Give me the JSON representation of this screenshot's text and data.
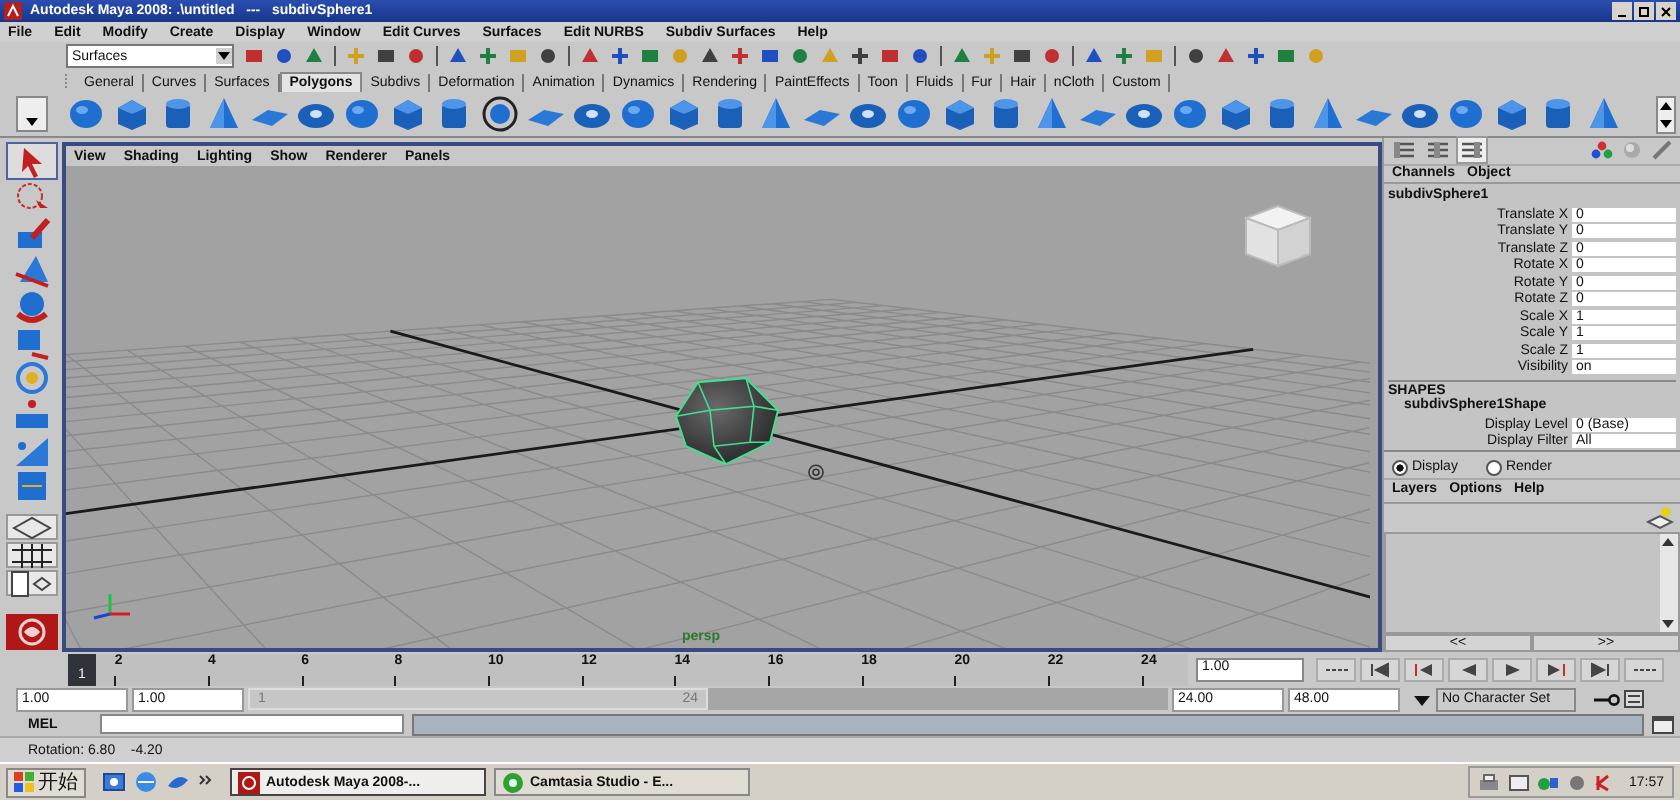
{
  "window": {
    "title": "Autodesk Maya 2008: .\\untitled   ---   subdivSphere1"
  },
  "menus": [
    "File",
    "Edit",
    "Modify",
    "Create",
    "Display",
    "Window",
    "Edit Curves",
    "Surfaces",
    "Edit NURBS",
    "Subdiv Surfaces",
    "Help"
  ],
  "status_line": {
    "menu_set": "Surfaces"
  },
  "shelf": {
    "tabs": [
      {
        "label": "General",
        "selected": false
      },
      {
        "label": "Curves",
        "selected": false
      },
      {
        "label": "Surfaces",
        "selected": false
      },
      {
        "label": "Polygons",
        "selected": true
      },
      {
        "label": "Subdivs",
        "selected": false
      },
      {
        "label": "Deformation",
        "selected": false
      },
      {
        "label": "Animation",
        "selected": false
      },
      {
        "label": "Dynamics",
        "selected": false
      },
      {
        "label": "Rendering",
        "selected": false
      },
      {
        "label": "PaintEffects",
        "selected": false
      },
      {
        "label": "Toon",
        "selected": false
      },
      {
        "label": "Fluids",
        "selected": false
      },
      {
        "label": "Fur",
        "selected": false
      },
      {
        "label": "Hair",
        "selected": false
      },
      {
        "label": "nCloth",
        "selected": false
      },
      {
        "label": "Custom",
        "selected": false
      }
    ]
  },
  "viewport": {
    "menus": [
      "View",
      "Shading",
      "Lighting",
      "Show",
      "Renderer",
      "Panels"
    ],
    "camera": "persp"
  },
  "channel_box": {
    "menus": [
      "Channels",
      "Object"
    ],
    "object": "subdivSphere1",
    "attributes": [
      {
        "name": "Translate X",
        "value": "0"
      },
      {
        "name": "Translate Y",
        "value": "0"
      },
      {
        "name": "Translate Z",
        "value": "0"
      },
      {
        "name": "Rotate X",
        "value": "0"
      },
      {
        "name": "Rotate Y",
        "value": "0"
      },
      {
        "name": "Rotate Z",
        "value": "0"
      },
      {
        "name": "Scale X",
        "value": "1"
      },
      {
        "name": "Scale Y",
        "value": "1"
      },
      {
        "name": "Scale Z",
        "value": "1"
      },
      {
        "name": "Visibility",
        "value": "on"
      }
    ],
    "shapes_heading": "SHAPES",
    "shape": "subdivSphere1Shape",
    "shape_attributes": [
      {
        "name": "Display Level",
        "value": "0 (Base)"
      },
      {
        "name": "Display Filter",
        "value": "All"
      }
    ]
  },
  "layer_editor": {
    "modes": [
      {
        "label": "Display",
        "selected": true
      },
      {
        "label": "Render",
        "selected": false
      }
    ],
    "menus": [
      "Layers",
      "Options",
      "Help"
    ],
    "scroll_left": "<<",
    "scroll_right": ">>"
  },
  "time_slider": {
    "current_frame": "1",
    "level": 0,
    "labels": [
      "2",
      "4",
      "6",
      "8",
      "10",
      "12",
      "14",
      "16",
      "18",
      "20",
      "22",
      "24"
    ],
    "current_time": "1.00"
  },
  "range_slider": {
    "start_time": "1.00",
    "playback_start": "1.00",
    "range_start": "1",
    "range_end": "24",
    "level": 0.5,
    "playback_end": "24.00",
    "end_time": "48.00",
    "character_set": "No Character Set"
  },
  "command_line": {
    "label": "MEL"
  },
  "help_line": {
    "text": "Rotation: 6.80    -4.20"
  },
  "taskbar": {
    "start": "开始",
    "tasks": [
      {
        "label": "Autodesk Maya 2008-...",
        "selected": true
      },
      {
        "label": "Camtasia Studio - E...",
        "selected": false
      }
    ],
    "clock": "17:57"
  }
}
